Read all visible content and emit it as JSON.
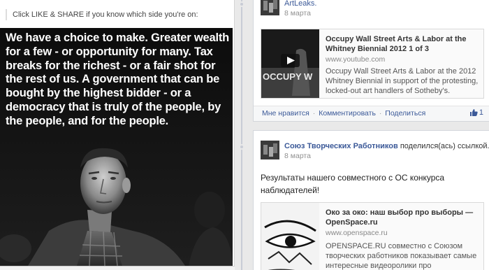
{
  "left_post": {
    "caption": "Click LIKE & SHARE if you know which side you're on:",
    "image_text": "We have a choice to make. Greater wealth for a few - or opportunity for many. Tax breaks for the richest - or a fair shot for the rest of us. A government that can be bought by the highest bidder - or a democracy that is truly of the people, by the people, and for the people."
  },
  "post_top": {
    "author_line": "Союз Творческих Работников поделился(ась) ссылкой ArtLeaks.",
    "author_tail": "ArtLeaks.",
    "timestamp": "8 марта",
    "share": {
      "title": "Occupy Wall Street Arts & Labor at the Whitney Biennial 2012 1 of 3",
      "url": "www.youtube.com",
      "description": "Occupy Wall Street Arts & Labor at the 2012 Whitney Biennial in support of the protesting, locked-out art handlers of Sotheby's.",
      "thumb_text": "OCCUPY W"
    },
    "actions": {
      "like": "Мне нравится",
      "comment": "Комментировать",
      "share": "Поделиться",
      "separator": "·"
    },
    "like_count": "1"
  },
  "post_bottom": {
    "author_name": "Союз Творческих Работников",
    "author_suffix": "поделился(ась) ссылкой.",
    "timestamp": "8 марта",
    "text": "Результаты нашего совместного с ОС конкурса наблюдателей!",
    "share": {
      "title": "Око за око: наш выбор про выборы — OpenSpace.ru",
      "url": "www.openspace.ru",
      "description": "OPENSPACE.RU совместно с Союзом творческих работников показывает самые интересные видеоролики про"
    }
  },
  "colors": {
    "link": "#3b5998",
    "background": "#e9e9e9"
  }
}
